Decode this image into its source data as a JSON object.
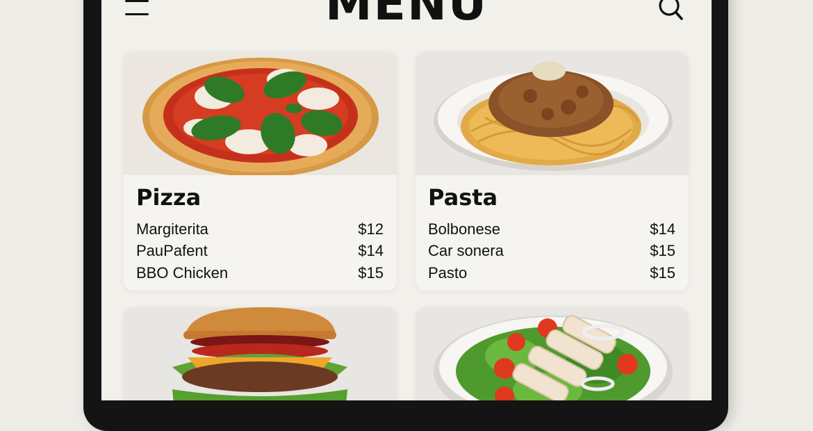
{
  "header": {
    "title": "MENU"
  },
  "icons": {
    "menu": "hamburger-menu-icon",
    "search": "search-icon"
  },
  "categories": [
    {
      "name": "Pizza",
      "image": "pizza-image",
      "items": [
        {
          "name": "Margiterita",
          "price": "$12"
        },
        {
          "name": "PauPafent",
          "price": "$14"
        },
        {
          "name": "BBO Chicken",
          "price": "$15"
        }
      ]
    },
    {
      "name": "Pasta",
      "image": "pasta-image",
      "items": [
        {
          "name": "Bolbonese",
          "price": "$14"
        },
        {
          "name": "Car sonera",
          "price": "$15"
        },
        {
          "name": "Pasto",
          "price": "$15"
        }
      ]
    },
    {
      "name": "",
      "image": "burger-image",
      "items": []
    },
    {
      "name": "",
      "image": "salad-image",
      "items": []
    }
  ]
}
